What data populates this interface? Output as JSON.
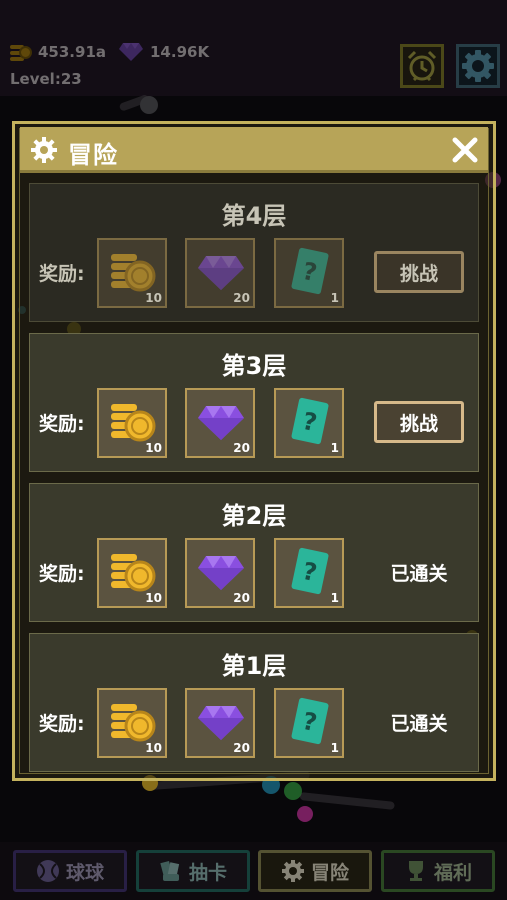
{
  "hud": {
    "gold": "453.91a",
    "gems": "14.96K",
    "level": "Level:23"
  },
  "dialog": {
    "title": "冒险",
    "reward_label": "奖励:",
    "challenge_label": "挑战",
    "cleared_label": "已通关",
    "floors": [
      {
        "name": "第4层",
        "coins": "10",
        "gems": "20",
        "cards": "1",
        "status": "challenge",
        "locked": true
      },
      {
        "name": "第3层",
        "coins": "10",
        "gems": "20",
        "cards": "1",
        "status": "challenge",
        "locked": false
      },
      {
        "name": "第2层",
        "coins": "10",
        "gems": "20",
        "cards": "1",
        "status": "cleared",
        "locked": false
      },
      {
        "name": "第1层",
        "coins": "10",
        "gems": "20",
        "cards": "1",
        "status": "cleared",
        "locked": false
      }
    ]
  },
  "nav": {
    "balls": "球球",
    "draw": "抽卡",
    "adventure": "冒险",
    "welfare": "福利"
  },
  "colors": {
    "gold": "#f0b82c",
    "gem": "#8a4fe0",
    "card": "#2bb59a",
    "panel_border": "#c4b25e"
  }
}
